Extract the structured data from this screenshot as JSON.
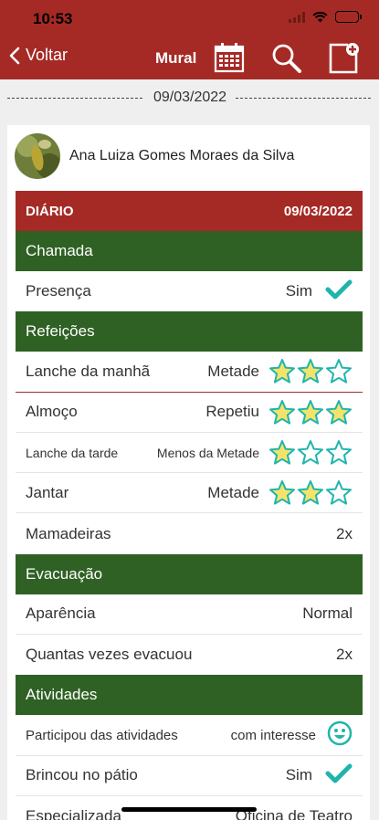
{
  "status_bar": {
    "time": "10:53"
  },
  "header": {
    "back_label": "Voltar",
    "title": "Mural"
  },
  "feed": {
    "date": "09/03/2022"
  },
  "student": {
    "name": "Ana Luiza Gomes Moraes da Silva"
  },
  "diary": {
    "header_label": "DIÁRIO",
    "header_date": "09/03/2022",
    "sections": [
      {
        "title": "Chamada",
        "rows": [
          {
            "label": "Presença",
            "value": "Sim",
            "icon": "check-icon"
          }
        ]
      },
      {
        "title": "Refeições",
        "rows": [
          {
            "label": "Lanche da manhã",
            "value": "Metade",
            "rating": 2,
            "max": 3
          },
          {
            "label": "Almoço",
            "value": "Repetiu",
            "rating": 3,
            "max": 3
          },
          {
            "label": "Lanche da tarde",
            "value": "Menos da Metade",
            "rating": 1,
            "max": 3
          },
          {
            "label": "Jantar",
            "value": "Metade",
            "rating": 2,
            "max": 3
          },
          {
            "label": "Mamadeiras",
            "value": "2x"
          }
        ]
      },
      {
        "title": "Evacuação",
        "rows": [
          {
            "label": "Aparência",
            "value": "Normal"
          },
          {
            "label": "Quantas vezes evacuou",
            "value": "2x"
          }
        ]
      },
      {
        "title": "Atividades",
        "rows": [
          {
            "label": "Participou das atividades",
            "value": "com interesse",
            "icon": "smiley-icon"
          },
          {
            "label": "Brincou no pátio",
            "value": "Sim",
            "icon": "check-icon"
          },
          {
            "label": "Especializada",
            "value": "Oficina de Teatro"
          }
        ]
      }
    ]
  },
  "colors": {
    "header": "#a52a25",
    "section": "#2f6124",
    "star": "#f3e36a",
    "accent": "#1fb5ac"
  }
}
